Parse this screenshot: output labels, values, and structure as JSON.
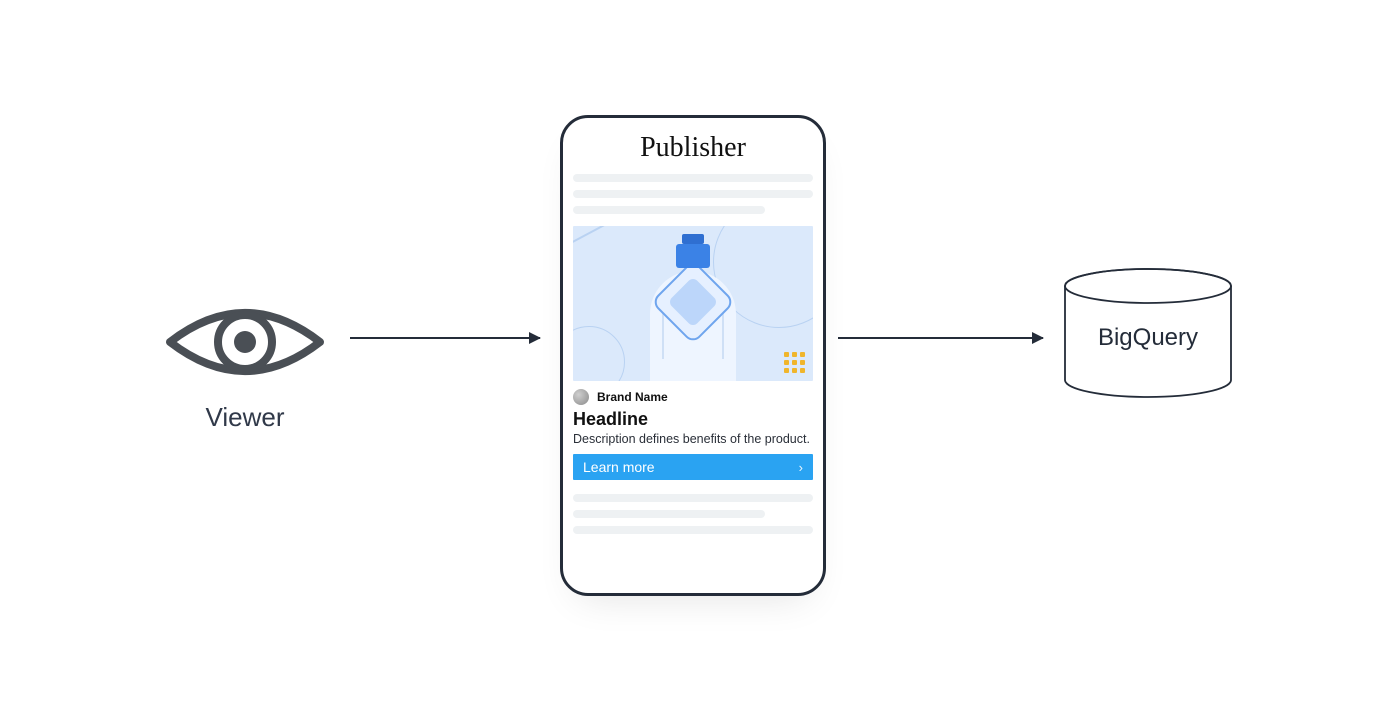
{
  "flow": {
    "viewer_label": "Viewer",
    "store_label": "BigQuery"
  },
  "phone": {
    "publisher_title": "Publisher",
    "ad": {
      "brand_name": "Brand Name",
      "headline": "Headline",
      "description": "Description defines benefits of the product.",
      "cta_label": "Learn more"
    }
  },
  "icons": {
    "eye": "eye-icon",
    "cylinder": "database-icon",
    "grid9": "grid-dots-icon",
    "chevron": "chevron-right-icon",
    "avatar": "brand-avatar-icon"
  }
}
